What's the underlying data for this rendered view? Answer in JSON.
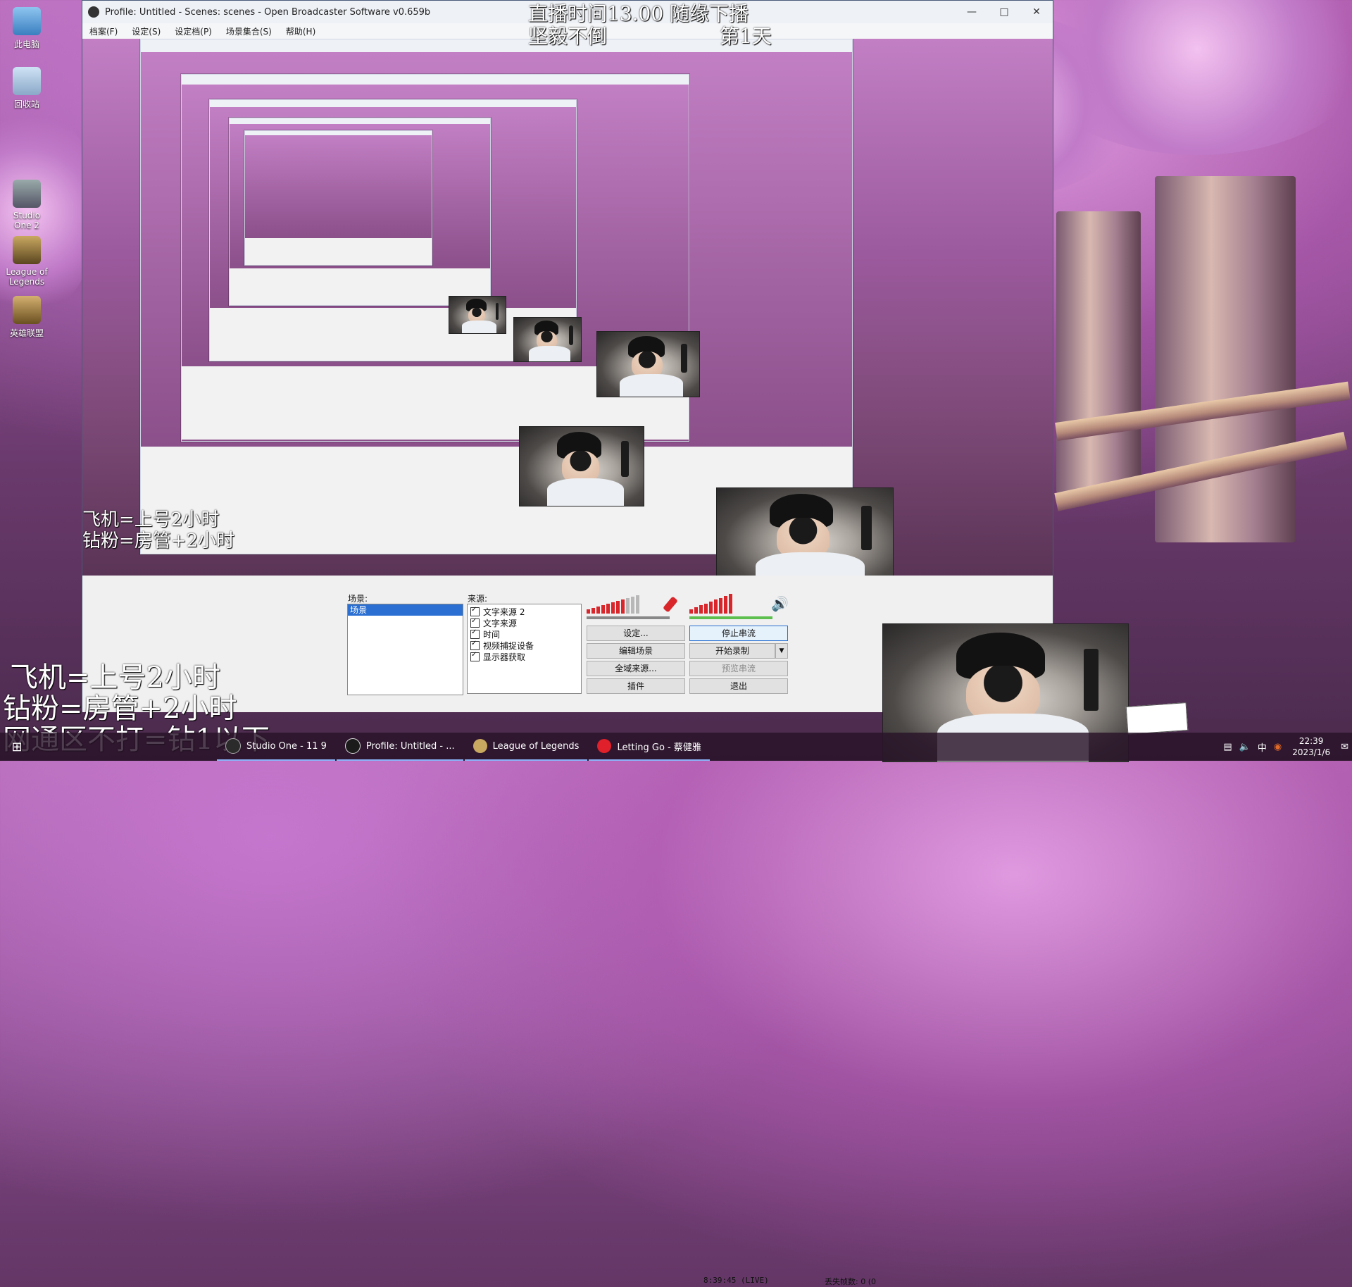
{
  "desktop_icons": [
    {
      "label": "此电脑"
    },
    {
      "label": "回收站"
    },
    {
      "label": "Studio One 2"
    },
    {
      "label": "League of Legends"
    },
    {
      "label": "英雄联盟"
    }
  ],
  "obs_window": {
    "title": "Profile: Untitled - Scenes: scenes - Open Broadcaster Software v0.659b",
    "menu": [
      "档案(F)",
      "设定(S)",
      "设定档(P)",
      "场景集合(S)",
      "帮助(H)"
    ],
    "controls": {
      "scenes_label": "场景:",
      "sources_label": "来源:",
      "scenes": [
        "场景"
      ],
      "sources": [
        "文字来源 2",
        "文字来源",
        "时间",
        "视频捕捉设备",
        "显示器获取"
      ],
      "buttons": {
        "settings": "设定...",
        "stop_stream": "停止串流",
        "edit_scene": "编辑场景",
        "start_record": "开始录制",
        "global_sources": "全域来源...",
        "preview_stream": "预览串流",
        "plugins": "插件",
        "exit": "退出"
      },
      "status": {
        "time": "8:39:45 (LIVE)",
        "dropped_frames": "丢失帧数: 0 (0"
      }
    }
  },
  "overlay": {
    "top_line1": "直播时间13.00 随缘下播",
    "top_line2": "坚毅不倒",
    "top_line3": "第1天",
    "bottom_line1": "飞机=上号2小时",
    "bottom_line2": "钻粉=房管+2小时",
    "bottom_line3": "网通区不打=钻1以下"
  },
  "taskbar": {
    "items": [
      {
        "label": "Studio One - 11 9"
      },
      {
        "label": "Profile: Untitled - ..."
      },
      {
        "label": "League of Legends"
      },
      {
        "label": "Letting Go - 蔡健雅"
      }
    ],
    "clock_time": "22:39",
    "clock_date": "2023/1/6",
    "tray_ime": "中"
  },
  "colors": {
    "accent": "#2a6fd1",
    "meter_red": "#d8262b",
    "netease_red": "#e0202a"
  }
}
